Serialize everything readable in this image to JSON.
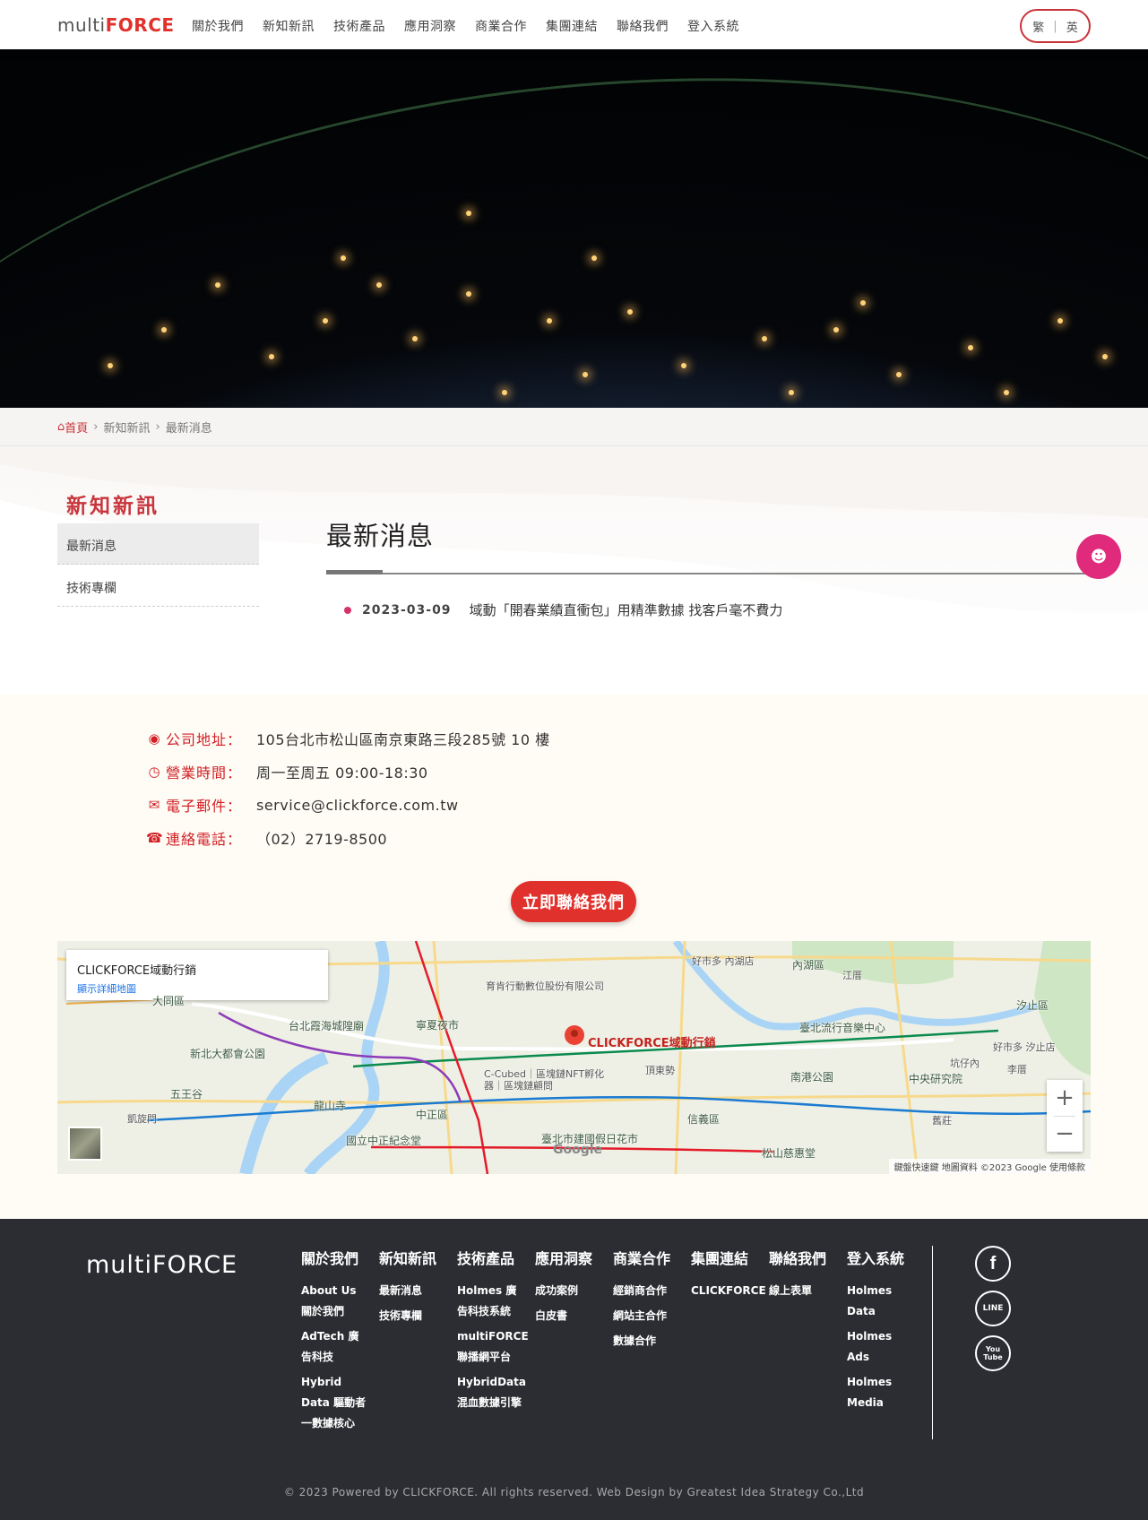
{
  "header": {
    "logo_part1": "multi",
    "logo_part2": "FORCE",
    "nav": [
      "關於我們",
      "新知新訊",
      "技術產品",
      "應用洞察",
      "商業合作",
      "集團連結",
      "聯絡我們",
      "登入系統"
    ],
    "lang_tc": "繁",
    "lang_sep": "|",
    "lang_en": "英"
  },
  "breadcrumb": {
    "home": "首頁",
    "level1": "新知新訊",
    "level2": "最新消息"
  },
  "sidebar": {
    "title": "新知新訊",
    "items": [
      {
        "label": "最新消息"
      },
      {
        "label": "技術專欄"
      }
    ]
  },
  "main": {
    "title": "最新消息",
    "news": [
      {
        "date": "2023-03-09",
        "title": "域動「開春業績直衝包」用精準數據 找客戶毫不費力"
      }
    ]
  },
  "contact": {
    "rows": [
      {
        "label": "公司地址：",
        "value": "105台北市松山區南京東路三段285號 10 樓",
        "icon": "map-pin-icon"
      },
      {
        "label": "營業時間：",
        "value": "周一至周五 09:00-18:30",
        "icon": "clock-icon"
      },
      {
        "label": "電子郵件：",
        "value": "service@clickforce.com.tw",
        "icon": "envelope-icon"
      },
      {
        "label": "連絡電話：",
        "value": "（02）2719-8500",
        "icon": "phone-icon"
      }
    ],
    "cta": "立即聯絡我們"
  },
  "map": {
    "place_name": "CLICKFORCE域動行銷",
    "details_link": "顯示詳細地圖",
    "pin_label": "CLICKFORCE域動行銷",
    "labels": [
      "大同區",
      "寧夏夜市",
      "台北霞海城隍廟",
      "新北大都會公園",
      "內湖區",
      "汐止區",
      "南港公園",
      "信義區",
      "中正區",
      "臺北流行音樂中心",
      "中央研究院",
      "龍山寺",
      "國立中正紀念堂",
      "臺北市建國假日花市",
      "松山慈惠堂",
      "五王谷",
      "凱旋門",
      "育肯行動數位股份有限公司",
      "C-Cubed｜區塊鏈NFT孵化器｜區塊鏈顧問",
      "好市多 內湖店",
      "好市多 汐止店",
      "頂東勢",
      "江厝",
      "李厝",
      "舊莊",
      "坑仔內"
    ],
    "google": "Google",
    "attribution": "鍵盤快速鍵  地圖資料 ©2023 Google  使用條款",
    "zoom_in": "+",
    "zoom_out": "−"
  },
  "footer": {
    "logo": "multiFORCE",
    "columns": [
      {
        "heading": "關於我們",
        "items": [
          "About Us 關於我們",
          "AdTech 廣告科技",
          "Hybrid Data 驅動者一數據核心"
        ]
      },
      {
        "heading": "新知新訊",
        "items": [
          "最新消息",
          "技術專欄"
        ]
      },
      {
        "heading": "技術產品",
        "items": [
          "Holmes 廣告科技系統",
          "multiFORCE 聯播網平台",
          "HybridData 混血數據引擎"
        ]
      },
      {
        "heading": "應用洞察",
        "items": [
          "成功案例",
          "白皮書"
        ]
      },
      {
        "heading": "商業合作",
        "items": [
          "經銷商合作",
          "網站主合作",
          "數據合作"
        ]
      },
      {
        "heading": "集團連結",
        "items": [
          "CLICKFORCE"
        ]
      },
      {
        "heading": "聯絡我們",
        "items": [
          "線上表單"
        ]
      },
      {
        "heading": "登入系統",
        "items": [
          "Holmes Data",
          "Holmes Ads",
          "Holmes Media"
        ]
      }
    ],
    "social": [
      {
        "name": "facebook-icon",
        "glyph": "f"
      },
      {
        "name": "line-icon",
        "glyph": "LINE"
      },
      {
        "name": "youtube-icon",
        "glyph": "You Tube"
      }
    ],
    "copyright": "© 2023 Powered by CLICKFORCE. All rights reserved. Web Design by Greatest Idea Strategy Co.,Ltd"
  }
}
